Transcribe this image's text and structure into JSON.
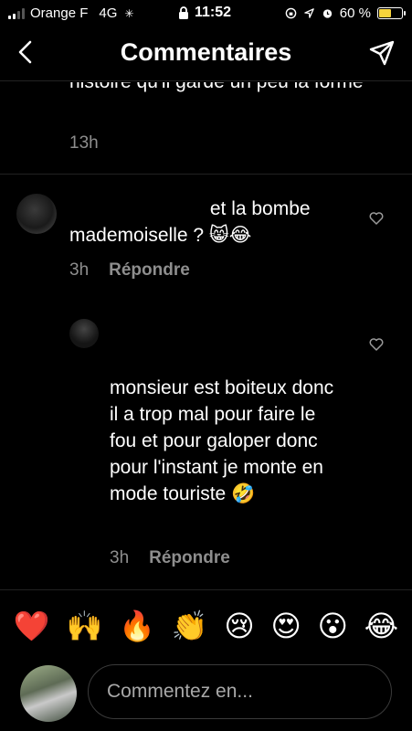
{
  "status_bar": {
    "carrier": "Orange F",
    "network": "4G",
    "time": "11:52",
    "battery": "60 %",
    "battery_level": 0.6,
    "battery_color": "#f6d33c"
  },
  "header": {
    "title": "Commentaires"
  },
  "comments": [
    {
      "text": "histoire qu'il garde un peu la forme",
      "time": "13h"
    },
    {
      "text_line1": "et la bombe",
      "text_line2": "mademoiselle ? 😸😂",
      "time": "3h",
      "reply_label": "Répondre"
    },
    {
      "text": "monsieur est boiteux donc il a trop mal pour faire le fou et pour galoper donc pour l'instant je monte en mode touriste 🤣",
      "time": "3h",
      "reply_label": "Répondre"
    }
  ],
  "emoji_bar": [
    "❤️",
    "🙌",
    "🔥",
    "👏",
    "😢",
    "😍",
    "😮",
    "😂"
  ],
  "input": {
    "placeholder": "Commentez en..."
  },
  "icons": {
    "back": "chevron-left-icon",
    "send": "paper-plane-icon",
    "like": "heart-outline-icon"
  }
}
